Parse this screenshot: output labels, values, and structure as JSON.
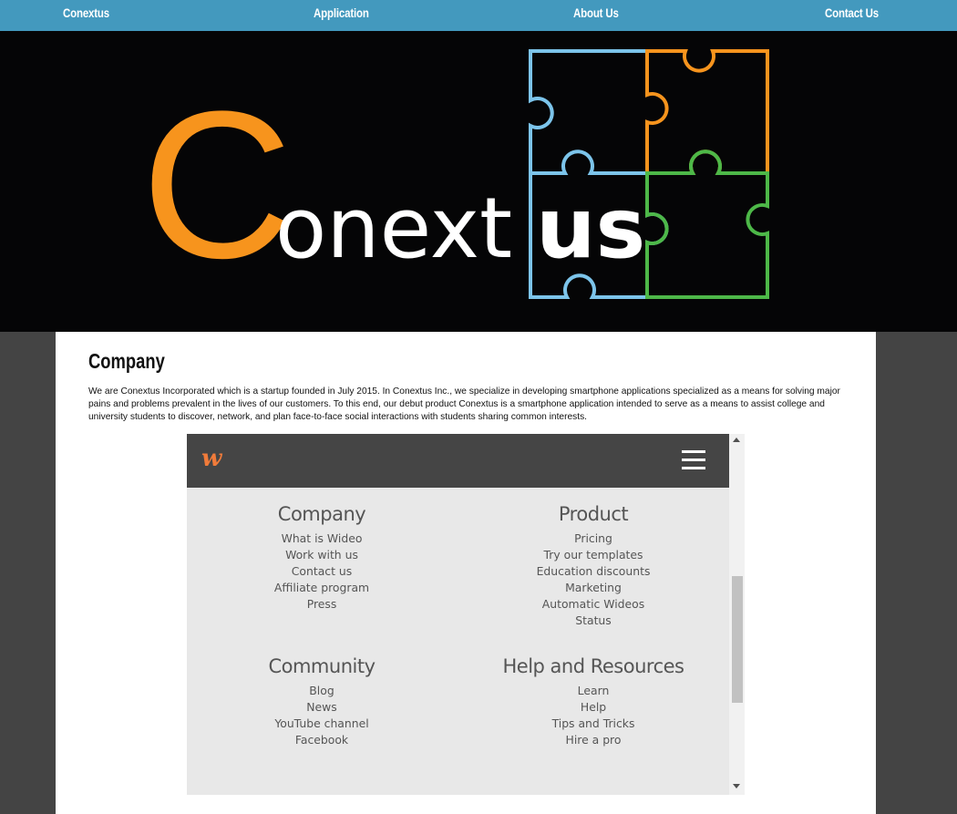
{
  "nav": {
    "items": [
      "Conextus",
      "Application",
      "About Us",
      "Contact Us"
    ]
  },
  "hero": {
    "logo_initial": "C",
    "logo_middle": "onext",
    "logo_end": "us",
    "colors": {
      "orange": "#f7941d",
      "blue": "#7cc4ea",
      "green": "#4db848",
      "white": "#ffffff"
    }
  },
  "company": {
    "heading": "Company",
    "paragraph": "We are Conextus Incorporated which is a startup founded in July 2015. In Conextus Inc., we specialize in developing smartphone applications specialized as a means for solving major pains and problems prevalent in the lives of our customers. To this end, our debut product Conextus is a smartphone application intended to serve as a means to assist college and university students to discover, network, and plan face-to-face social interactions with students sharing common interests."
  },
  "embed": {
    "logo": "w",
    "columns": [
      {
        "title": "Company",
        "links": [
          "What is Wideo",
          "Work with us",
          "Contact us",
          "Affiliate program",
          "Press"
        ]
      },
      {
        "title": "Product",
        "links": [
          "Pricing",
          "Try our templates",
          "Education discounts",
          "Marketing",
          "Automatic Wideos",
          "Status"
        ]
      },
      {
        "title": "Community",
        "links": [
          "Blog",
          "News",
          "YouTube channel",
          "Facebook"
        ]
      },
      {
        "title": "Help and Resources",
        "links": [
          "Learn",
          "Help",
          "Tips and Tricks",
          "Hire a pro"
        ]
      }
    ]
  }
}
